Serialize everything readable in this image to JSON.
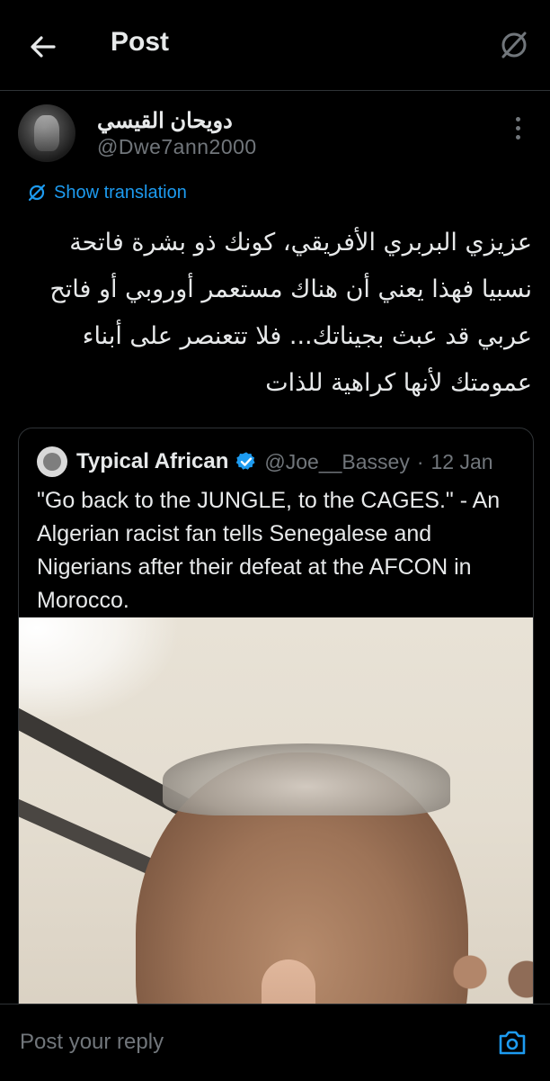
{
  "header": {
    "title": "Post"
  },
  "author": {
    "display_name": "دويحان القيسي",
    "handle": "@Dwe7ann2000"
  },
  "translation": {
    "label": "Show translation"
  },
  "post": {
    "text": "عزيزي البربري الأفريقي، كونك ذو بشرة فاتحة نسبيا فهذا يعني أن هناك مستعمر أوروبي أو فاتح عربي قد عبث بجيناتك... فلا تتعنصر على أبناء عمومتك لأنها كراهية للذات"
  },
  "quote": {
    "name": "Typical African",
    "handle": "@Joe__Bassey",
    "separator": "·",
    "date": "12 Jan",
    "text": "\"Go back to the JUNGLE, to the CAGES.\" - An Algerian racist fan tells Senegalese and Nigerians after their defeat at the AFCON in Morocco."
  },
  "reply": {
    "placeholder": "Post your reply"
  },
  "colors": {
    "background": "#000000",
    "accent": "#1d9bf0",
    "muted": "#71767b",
    "text": "#e7e9ea"
  }
}
